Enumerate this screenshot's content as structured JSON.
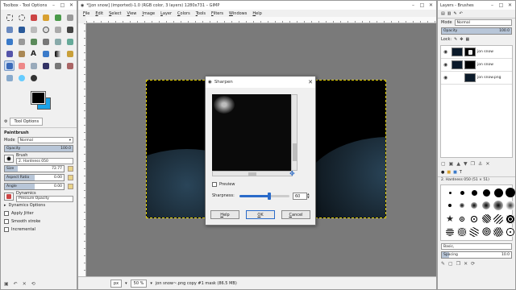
{
  "toolbox": {
    "title": "Toolbox - Tool Options",
    "tool_options_tab": "Tool Options",
    "tool_name": "Paintbrush",
    "mode_label": "Mode",
    "mode_value": "Normal",
    "opacity_label": "Opacity",
    "opacity_value": "100.0",
    "brush_label": "Brush",
    "brush_value": "2. Hardness 050",
    "size_label": "Size",
    "size_value": "72.77",
    "aspect_label": "Aspect Ratio",
    "aspect_value": "0.00",
    "angle_label": "Angle",
    "angle_value": "0.00",
    "dynamics_label": "Dynamics",
    "dynamics_value": "Pressure Opacity",
    "dynamics_options": "Dynamics Options",
    "apply_jitter": "Apply Jitter",
    "smooth_stroke": "Smooth stroke",
    "incremental": "Incremental"
  },
  "image_window": {
    "title": "*[jon snow] (imported)-1.0 (RGB color, 3 layers) 1280x731 – GIMP",
    "menu": [
      "File",
      "Edit",
      "Select",
      "View",
      "Image",
      "Layer",
      "Colors",
      "Tools",
      "Filters",
      "Windows",
      "Help"
    ],
    "unit": "px",
    "zoom": "50 %",
    "status_text": "jon snow~.png copy #1 mask (86.5 MB)"
  },
  "sharpen_dialog": {
    "title": "Sharpen",
    "preview_label": "Preview",
    "sharpness_label": "Sharpness:",
    "sharpness_value": "60",
    "help_button": "Help",
    "ok_button": "OK",
    "cancel_button": "Cancel"
  },
  "layers_dock": {
    "title": "Layers - Brushes",
    "mode_label": "Mode",
    "mode_value": "Normal",
    "opacity_label": "Opacity",
    "opacity_value": "100.0",
    "lock_label": "Lock:",
    "layers": [
      {
        "name": "jon snow"
      },
      {
        "name": "jon snow"
      },
      {
        "name": "jon snow.png"
      }
    ],
    "brush_name": "2. Hardness 050 (51 × 51)",
    "tag_value": "Basic,",
    "spacing_label": "Spacing",
    "spacing_value": "10.0"
  },
  "colors": {
    "foreground": "#000000",
    "background": "#1aa3e8",
    "accent": "#2a6bc9"
  }
}
